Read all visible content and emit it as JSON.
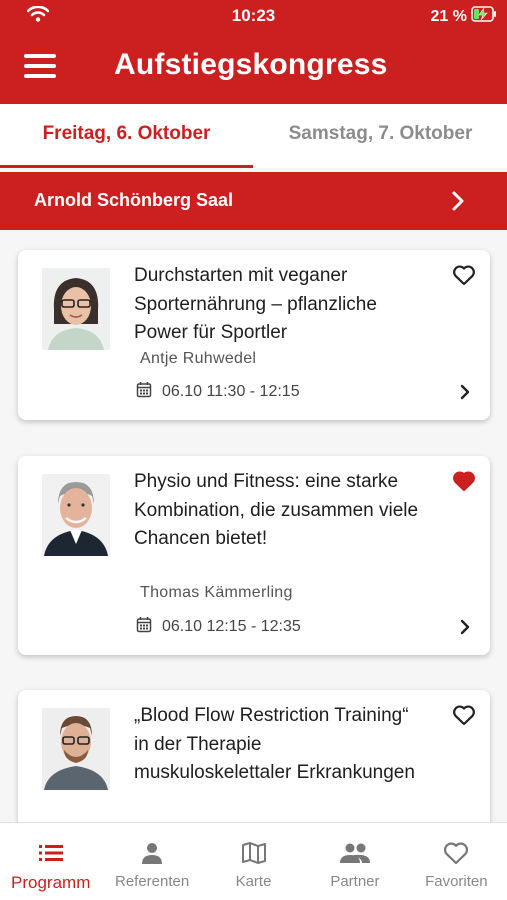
{
  "colors": {
    "accent": "#cc1f1f",
    "background": "#f6f6f6",
    "inactive": "#8c8c8c"
  },
  "status_bar": {
    "time": "10:23",
    "battery": "21 %"
  },
  "app_bar": {
    "title": "Aufstiegskongress",
    "menu_icon": "hamburger-menu-icon"
  },
  "tabs": [
    {
      "label": "Freitag, 6. Oktober",
      "active": true
    },
    {
      "label": "Samstag, 7. Oktober",
      "active": false
    }
  ],
  "room": {
    "label": "Arnold Schönberg Saal"
  },
  "sessions": [
    {
      "title": "Durchstarten mit veganer Sporternährung – pflanzliche Power für Sportler",
      "speaker": "Antje Ruhwedel",
      "time": "06.10 11:30 - 12:15",
      "favorite": false
    },
    {
      "title": "Physio und Fitness: eine starke Kombination, die zusammen viele Chancen bietet!",
      "speaker": "Thomas Kämmerling",
      "time": "06.10 12:15 - 12:35",
      "favorite": true
    },
    {
      "title": "„Blood Flow Restriction Training“ in der Therapie muskuloskelettaler Erkrankungen",
      "speaker": "",
      "time": "",
      "favorite": false
    }
  ],
  "bottom_nav": [
    {
      "label": "Programm",
      "icon": "list-icon",
      "active": true
    },
    {
      "label": "Referenten",
      "icon": "person-icon",
      "active": false
    },
    {
      "label": "Karte",
      "icon": "map-icon",
      "active": false
    },
    {
      "label": "Partner",
      "icon": "group-icon",
      "active": false
    },
    {
      "label": "Favoriten",
      "icon": "heart-outline-icon",
      "active": false
    }
  ]
}
